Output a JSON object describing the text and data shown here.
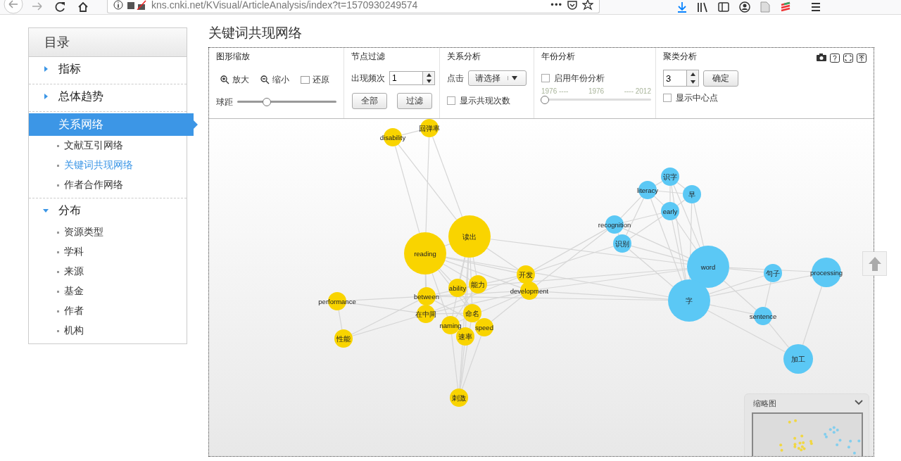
{
  "browser": {
    "url": "kns.cnki.net/KVisual/ArticleAnalysis/index?t=1570930249574",
    "more": "•••"
  },
  "sidebar": {
    "title": "目录",
    "items": [
      {
        "label": "指标",
        "expanded": false,
        "selected": false
      },
      {
        "label": "总体趋势",
        "expanded": false,
        "selected": false
      },
      {
        "label": "关系网络",
        "expanded": true,
        "selected": true,
        "children": [
          {
            "label": "文献互引网络",
            "selected": false
          },
          {
            "label": "关键词共现网络",
            "selected": true
          },
          {
            "label": "作者合作网络",
            "selected": false
          }
        ]
      },
      {
        "label": "分布",
        "expanded": true,
        "selected": false,
        "children": [
          {
            "label": "资源类型",
            "selected": false
          },
          {
            "label": "学科",
            "selected": false
          },
          {
            "label": "来源",
            "selected": false
          },
          {
            "label": "基金",
            "selected": false
          },
          {
            "label": "作者",
            "selected": false
          },
          {
            "label": "机构",
            "selected": false
          }
        ]
      }
    ]
  },
  "page_title": "关键词共现网络",
  "toolbar": {
    "zoom": {
      "title": "图形缩放",
      "zoom_in": "放大",
      "zoom_out": "缩小",
      "reset": "还原",
      "spacing_label": "球距",
      "level": 0.3
    },
    "filter": {
      "title": "节点过滤",
      "frequency_label": "出现频次",
      "frequency": "1",
      "all": "全部",
      "apply": "过滤"
    },
    "relation": {
      "title": "关系分析",
      "click_label": "点击",
      "select": "请选择",
      "show_counts": {
        "label": "显示共现次数",
        "checked": false
      }
    },
    "year": {
      "title": "年份分析",
      "enable": {
        "label": "启用年份分析",
        "checked": false
      },
      "from": "1976 ----",
      "current": "1976",
      "to": "---- 2012",
      "level": 0
    },
    "cluster": {
      "title": "聚类分析",
      "count": "3",
      "confirm": "确定",
      "show_center": {
        "label": "显示中心点",
        "checked": false
      }
    }
  },
  "nodes": [
    {
      "label": "disability",
      "color": "#f9d400"
    },
    {
      "label": "回弹率",
      "color": "#f9d400"
    },
    {
      "label": "reading",
      "color": "#f9d400"
    },
    {
      "label": "读出",
      "color": "#f9d400"
    },
    {
      "label": "开发",
      "color": "#f9d400"
    },
    {
      "label": "development",
      "color": "#f9d400"
    },
    {
      "label": "能力",
      "color": "#f9d400"
    },
    {
      "label": "ability",
      "color": "#f9d400"
    },
    {
      "label": "between",
      "color": "#f9d400"
    },
    {
      "label": "在中间",
      "color": "#f9d400"
    },
    {
      "label": "命名",
      "color": "#f9d400"
    },
    {
      "label": "naming",
      "color": "#f9d400"
    },
    {
      "label": "speed",
      "color": "#f9d400"
    },
    {
      "label": "速率",
      "color": "#f9d400"
    },
    {
      "label": "performance",
      "color": "#f9d400"
    },
    {
      "label": "性能",
      "color": "#f9d400"
    },
    {
      "label": "刺激",
      "color": "#f9d400"
    },
    {
      "label": "识字",
      "color": "#5bc8f5"
    },
    {
      "label": "literacy",
      "color": "#5bc8f5"
    },
    {
      "label": "早",
      "color": "#5bc8f5"
    },
    {
      "label": "early",
      "color": "#5bc8f5"
    },
    {
      "label": "recognition",
      "color": "#5bc8f5"
    },
    {
      "label": "识别",
      "color": "#5bc8f5"
    },
    {
      "label": "word",
      "color": "#5bc8f5"
    },
    {
      "label": "字",
      "color": "#5bc8f5"
    },
    {
      "label": "句子",
      "color": "#5bc8f5"
    },
    {
      "label": "processing",
      "color": "#5bc8f5"
    },
    {
      "label": "sentence",
      "color": "#5bc8f5"
    },
    {
      "label": "加工",
      "color": "#5bc8f5"
    }
  ],
  "minimap": {
    "title": "缩略图"
  }
}
